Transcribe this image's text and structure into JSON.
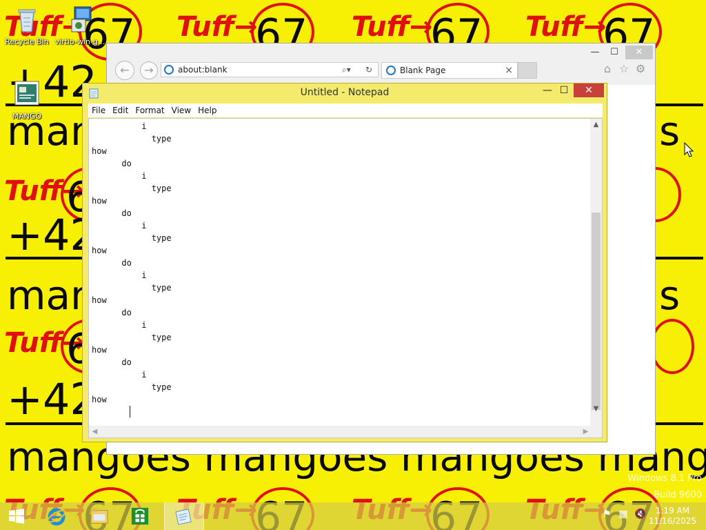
{
  "wallpaper": {
    "rows": [
      {
        "tag": "Tuff→",
        "num": "67"
      },
      {
        "tag": "Tuff→",
        "num": "67"
      },
      {
        "tag": "Tuff→",
        "num": "67"
      },
      {
        "tag": "Tuff→",
        "num": "67"
      }
    ],
    "colors": {
      "background": "#f7f004",
      "ink_red": "#e01010",
      "ink_black": "#0a0a0a"
    }
  },
  "desktop": {
    "icons": [
      {
        "name": "recycle-bin",
        "label": "Recycle Bin"
      },
      {
        "name": "virtio-win",
        "label": "virtio-win-g..."
      },
      {
        "name": "mango",
        "label": "MANGO"
      }
    ]
  },
  "ie": {
    "address": "about:blank",
    "tab_title": "Blank Page",
    "tab_close": "×",
    "minimize": "—",
    "maximize": "☐",
    "close": "✕",
    "icons": [
      "back-icon",
      "forward-icon",
      "search-icon",
      "refresh-icon",
      "home-icon",
      "favorites-icon",
      "settings-icon"
    ]
  },
  "notepad": {
    "title": "Untitled - Notepad",
    "minimize": "—",
    "maximize": "☐",
    "close": "✕",
    "menu": [
      "File",
      "Edit",
      "Format",
      "View",
      "Help"
    ],
    "lines": [
      "          i",
      "            type",
      "how",
      "      do",
      "          i",
      "            type",
      "how",
      "      do",
      "          i",
      "            type",
      "how",
      "      do",
      "          i",
      "            type",
      "how",
      "      do",
      "          i",
      "            type",
      "how",
      "      do",
      "          i",
      "            type",
      "how",
      "      "
    ]
  },
  "watermark": {
    "line1": "Windows 8.1 Pro",
    "line2": "Build 9600"
  },
  "taskbar": {
    "items": [
      "start-button",
      "internet-explorer",
      "file-explorer",
      "store",
      "notepad"
    ],
    "active": "notepad",
    "clock_time": "1:19 AM",
    "clock_date": "11/16/2025"
  }
}
